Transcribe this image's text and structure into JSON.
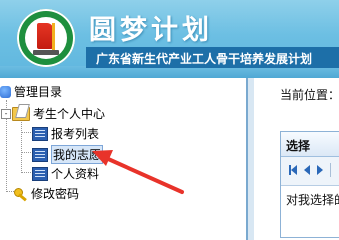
{
  "header": {
    "title": "圆梦计划",
    "subtitle": "广东省新生代产业工人骨干培养发展计划",
    "logo_icon": "program-logo"
  },
  "tree": {
    "root_label": "管理目录",
    "group_label": "考生个人中心",
    "group_expander": "-",
    "items": [
      {
        "label": "报考列表",
        "icon": "page-icon"
      },
      {
        "label": "我的志愿",
        "icon": "page-icon",
        "selected": true
      },
      {
        "label": "个人资料",
        "icon": "page-icon"
      }
    ],
    "password_label": "修改密码",
    "password_icon": "key-icon"
  },
  "right": {
    "location_label": "当前位置：",
    "grid_header": "选择",
    "grid_note": "对我选择的"
  },
  "colors": {
    "header_blue": "#6cbfe3",
    "subtitle_bar": "#1d6fa8",
    "annotation_arrow": "#e8332a"
  }
}
